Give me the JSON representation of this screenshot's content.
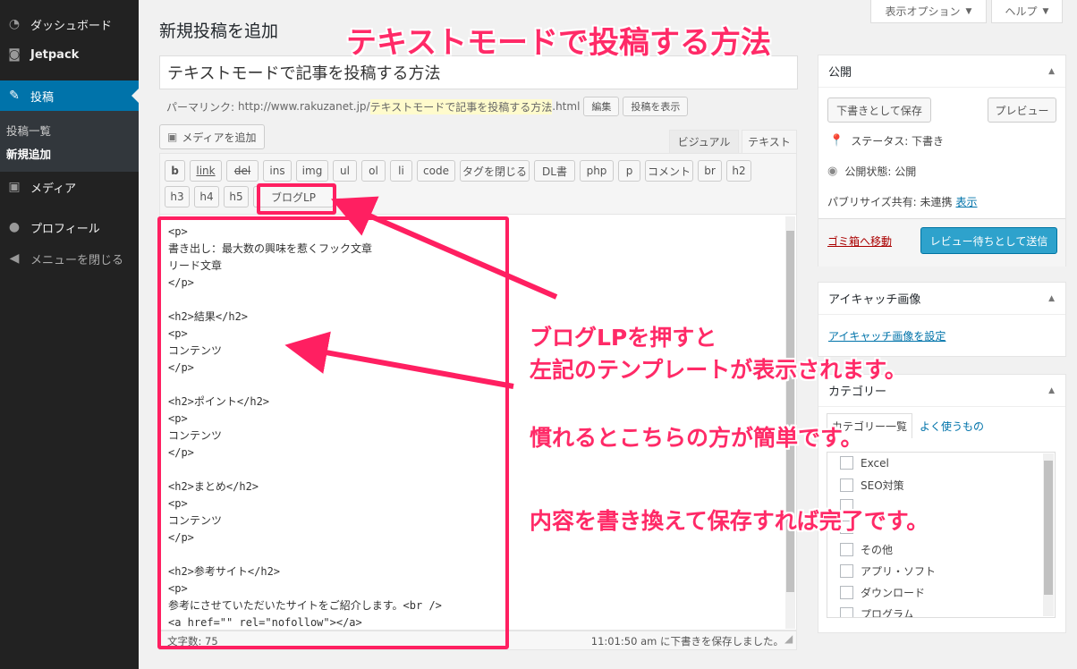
{
  "sidebar": {
    "items": [
      {
        "label": "ダッシュボード",
        "icon": "dashboard-icon"
      },
      {
        "label": "Jetpack",
        "icon": "jetpack-icon"
      },
      {
        "label": "投稿",
        "icon": "pin-icon"
      },
      {
        "label": "メディア",
        "icon": "media-icon"
      },
      {
        "label": "プロフィール",
        "icon": "user-icon"
      },
      {
        "label": "メニューを閉じる",
        "icon": "collapse-icon"
      }
    ],
    "submenu": [
      "投稿一覧",
      "新規追加"
    ]
  },
  "topbar": {
    "screen_options": "表示オプション",
    "help": "ヘルプ"
  },
  "main": {
    "page_title": "新規投稿を追加",
    "post_title": "テキストモードで記事を投稿する方法",
    "permalink": {
      "label": "パーマリンク:",
      "base": "http://www.rakuzanet.jp/",
      "slug": "テキストモードで記事を投稿する方法",
      "suffix": ".html",
      "edit_button": "編集",
      "view_button": "投稿を表示"
    },
    "add_media": "メディアを追加",
    "tabs": {
      "visual": "ビジュアル",
      "text": "テキスト"
    },
    "quicktags": [
      "b",
      "link",
      "del",
      "ins",
      "img",
      "ul",
      "ol",
      "li",
      "code",
      "タグを閉じる",
      "DL書",
      "php",
      "p",
      "コメント",
      "br",
      "h2",
      "h3",
      "h4",
      "h5",
      "ブログLP"
    ],
    "editor_lines": [
      "<p>",
      "書き出し：最大数の興味を惹くフック文章",
      "リード文章",
      "</p>",
      "",
      "<h2>結果</h2>",
      "<p>",
      "コンテンツ",
      "</p>",
      "",
      "<h2>ポイント</h2>",
      "<p>",
      "コンテンツ",
      "</p>",
      "",
      "<h2>まとめ</h2>",
      "<p>",
      "コンテンツ",
      "</p>",
      "",
      "<h2>参考サイト</h2>",
      "<p>",
      "参考にさせていただいたサイトをご紹介します。<br />",
      "<a href=\"\" rel=\"nofollow\"></a>"
    ],
    "word_count": "文字数: 75",
    "draft_saved": "11:01:50 am に下書きを保存しました。"
  },
  "publish": {
    "title": "公開",
    "save_draft": "下書きとして保存",
    "preview": "プレビュー",
    "status": "ステータス: 下書き",
    "visibility": "公開状態: 公開",
    "publicize_label": "パブリサイズ共有: 未連携",
    "publicize_link": "表示",
    "trash": "ゴミ箱へ移動",
    "submit": "レビュー待ちとして送信"
  },
  "featured_image": {
    "title": "アイキャッチ画像",
    "link": "アイキャッチ画像を設定"
  },
  "categories": {
    "title": "カテゴリー",
    "tab_all": "カテゴリー一覧",
    "tab_popular": "よく使うもの",
    "items": [
      "Excel",
      "SEO対策",
      "その他",
      "アプリ・ソフト",
      "ダウンロード",
      "プログラム"
    ]
  },
  "annotations": {
    "headline": "テキストモードで投稿する方法",
    "note1_line1": "ブログLPを押すと",
    "note1_line2": "左記のテンプレートが表示されます。",
    "note2": "慣れるとこちらの方が簡単です。",
    "note3": "内容を書き換えて保存すれば完了です。"
  },
  "colors": {
    "accent": "#ff1f61",
    "sidebar": "#222222",
    "active": "#0073aa",
    "primary_button": "#2ea2cc"
  }
}
